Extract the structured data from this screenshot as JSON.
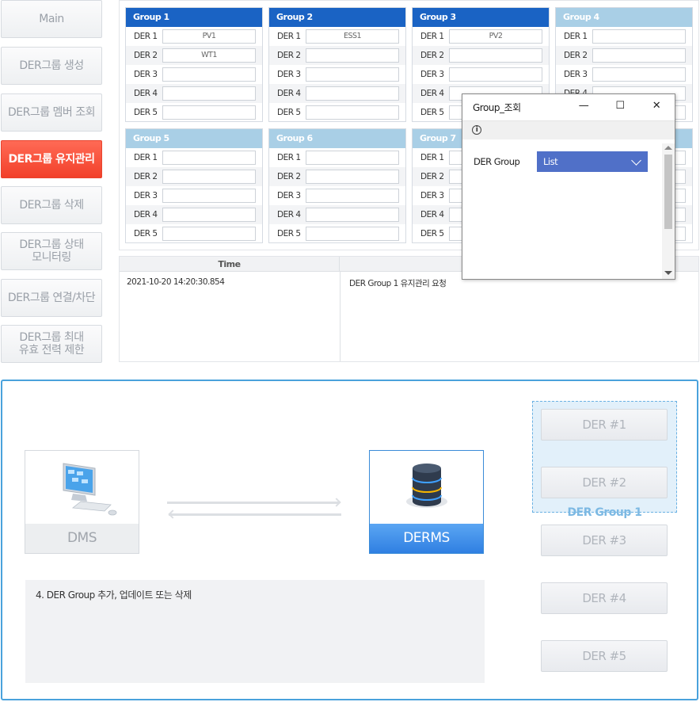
{
  "nav": {
    "items": [
      {
        "label": "Main"
      },
      {
        "label": "DER그룹 생성"
      },
      {
        "label": "DER그룹 멤버 조회"
      },
      {
        "label": "DER그룹 유지관리"
      },
      {
        "label": "DER그룹 삭제"
      },
      {
        "label": "DER그룹 상태\n모니터링"
      },
      {
        "label": "DER그룹 연결/차단"
      },
      {
        "label": "DER그룹 최대\n유효 전력 제한"
      }
    ],
    "active_index": 3
  },
  "groups": [
    {
      "title": "Group 1",
      "rows": [
        {
          "label": "DER 1",
          "value": "PV1"
        },
        {
          "label": "DER 2",
          "value": "WT1"
        },
        {
          "label": "DER 3",
          "value": ""
        },
        {
          "label": "DER 4",
          "value": ""
        },
        {
          "label": "DER 5",
          "value": ""
        }
      ]
    },
    {
      "title": "Group 2",
      "rows": [
        {
          "label": "DER 1",
          "value": "ESS1"
        },
        {
          "label": "DER 2",
          "value": ""
        },
        {
          "label": "DER 3",
          "value": ""
        },
        {
          "label": "DER 4",
          "value": ""
        },
        {
          "label": "DER 5",
          "value": ""
        }
      ]
    },
    {
      "title": "Group 3",
      "rows": [
        {
          "label": "DER 1",
          "value": "PV2"
        },
        {
          "label": "DER 2",
          "value": ""
        },
        {
          "label": "DER 3",
          "value": ""
        },
        {
          "label": "DER 4",
          "value": ""
        },
        {
          "label": "DER 5",
          "value": ""
        }
      ]
    },
    {
      "title": "Group 4",
      "rows": [
        {
          "label": "DER 1",
          "value": ""
        },
        {
          "label": "DER 2",
          "value": ""
        },
        {
          "label": "DER 3",
          "value": ""
        },
        {
          "label": "DER 4",
          "value": ""
        },
        {
          "label": "DER 5",
          "value": ""
        }
      ]
    },
    {
      "title": "Group 5",
      "rows": [
        {
          "label": "DER 1",
          "value": ""
        },
        {
          "label": "DER 2",
          "value": ""
        },
        {
          "label": "DER 3",
          "value": ""
        },
        {
          "label": "DER 4",
          "value": ""
        },
        {
          "label": "DER 5",
          "value": ""
        }
      ]
    },
    {
      "title": "Group 6",
      "rows": [
        {
          "label": "DER 1",
          "value": ""
        },
        {
          "label": "DER 2",
          "value": ""
        },
        {
          "label": "DER 3",
          "value": ""
        },
        {
          "label": "DER 4",
          "value": ""
        },
        {
          "label": "DER 5",
          "value": ""
        }
      ]
    },
    {
      "title": "Group 7",
      "rows": [
        {
          "label": "DER 1",
          "value": ""
        },
        {
          "label": "DER 2",
          "value": ""
        },
        {
          "label": "DER 3",
          "value": ""
        },
        {
          "label": "DER 4",
          "value": ""
        },
        {
          "label": "DER 5",
          "value": ""
        }
      ]
    },
    {
      "title": "",
      "rows": [
        {
          "label": "",
          "value": ""
        },
        {
          "label": "",
          "value": ""
        },
        {
          "label": "",
          "value": ""
        },
        {
          "label": "",
          "value": ""
        },
        {
          "label": "",
          "value": ""
        }
      ]
    }
  ],
  "log": {
    "time_header": "Time",
    "message_header": "",
    "entries": [
      {
        "time": "2021-10-20 14:20:30.854",
        "message": "DER Group 1 유지관리 요청"
      }
    ]
  },
  "dialog": {
    "title": "Group_조회",
    "minimize_glyph": "—",
    "maximize_glyph": "☐",
    "close_glyph": "✕",
    "info_glyph": "i",
    "field_label": "DER Group",
    "select_value": "List"
  },
  "diagram": {
    "dms_label": "DMS",
    "derms_label": "DERMS",
    "der_buttons": [
      "DER #1",
      "DER #2",
      "DER #3",
      "DER #4",
      "DER #5"
    ],
    "group_label": "DER Group 1",
    "description": "4. DER Group 추가, 업데이트 또는 삭제"
  },
  "colors": {
    "accent_red": "#f2402a",
    "group_header_dark": "#1a63c4",
    "group_header_light": "#a9cfe6",
    "diagram_border": "#4aa2dc",
    "derms_blue": "#2f7fe2",
    "select_blue": "#5070c8"
  }
}
